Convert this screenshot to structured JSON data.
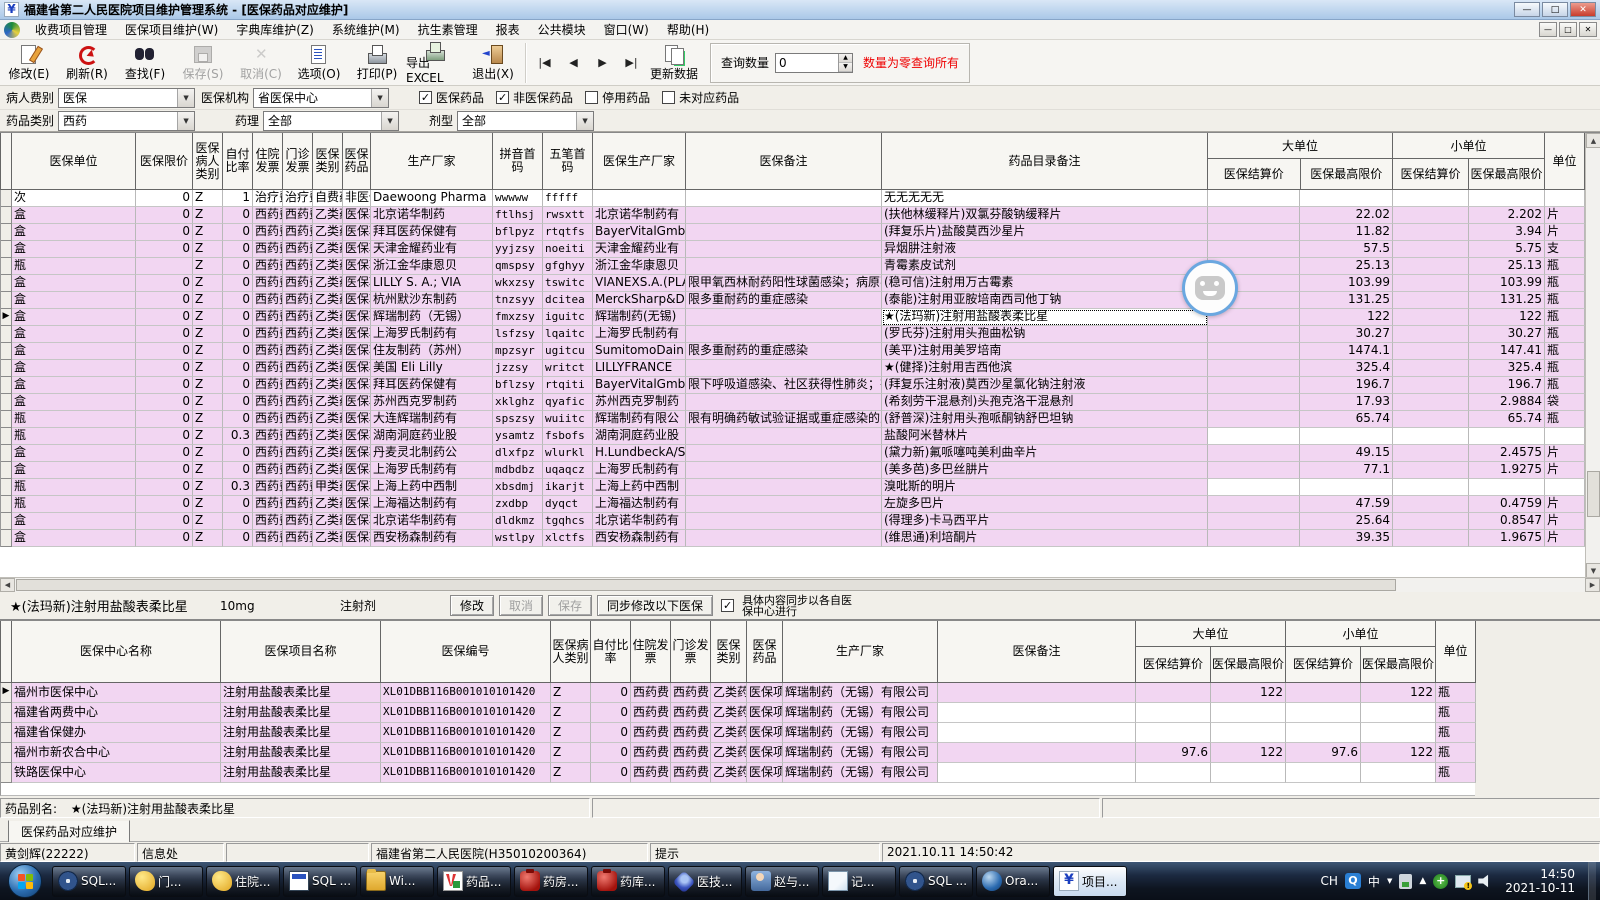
{
  "window": {
    "title": "福建省第二人民医院项目维护管理系统 - [医保药品对应维护]"
  },
  "icons": {
    "dropdown": "▼",
    "spin_up": "▲",
    "spin_down": "▼",
    "check": "✓",
    "nav_first": "|◀",
    "nav_prev": "◀",
    "nav_next": "▶",
    "nav_last": "▶|",
    "scroll_up": "▲",
    "scroll_down": "▼",
    "scroll_left": "◀",
    "scroll_right": "▶",
    "minimize": "—",
    "maximize": "□",
    "close": "✕",
    "restore": "□",
    "app_glyph": "¥"
  },
  "menu": [
    "收费项目管理",
    "医保项目维护(W)",
    "字典库维护(Z)",
    "系统维护(M)",
    "抗生素管理",
    "报表",
    "公共模块",
    "窗口(W)",
    "帮助(H)"
  ],
  "toolbar": {
    "buttons": [
      {
        "label": "修改(E)"
      },
      {
        "label": "刷新(R)"
      },
      {
        "label": "查找(F)"
      },
      {
        "label": "保存(S)"
      },
      {
        "label": "取消(C)"
      },
      {
        "label": "选项(O)"
      },
      {
        "label": "打印(P)"
      },
      {
        "label": "导出EXCEL"
      },
      {
        "label": "退出(X)"
      }
    ],
    "update_label": "更新数据",
    "query_label": "查询数量",
    "query_value": "0",
    "query_hint": "数量为零查询所有",
    "hint_color": "#ee0000"
  },
  "filters": {
    "patient_fee_label": "病人费别",
    "patient_fee_value": "医保",
    "org_label": "医保机构",
    "org_value": "省医保中心",
    "checks": [
      {
        "label": "医保药品",
        "state": "on"
      },
      {
        "label": "非医保药品",
        "state": "on"
      },
      {
        "label": "停用药品",
        "state": "off"
      },
      {
        "label": "未对应药品",
        "state": "off"
      }
    ],
    "drug_class_label": "药品类别",
    "drug_class_value": "西药",
    "pharm_label": "药理",
    "pharm_value": "全部",
    "form_label": "剂型",
    "form_value": "全部"
  },
  "main_table": {
    "headers": {
      "unit": "医保单位",
      "limit": "医保限价",
      "ptype": "医保病人类别",
      "ratio": "自付比率",
      "inv_in": "住院发票",
      "inv_out": "门诊发票",
      "cls": "医保类别",
      "drug": "医保药品",
      "factory": "生产厂家",
      "py": "拼音首码",
      "wb": "五笔首码",
      "yb_factory": "医保生产厂家",
      "remark": "医保备注",
      "catalog": "药品目录备注",
      "big": "大单位",
      "small": "小单位",
      "settle": "医保结算价",
      "max": "医保最高限价",
      "unit2": "单位"
    },
    "rows": [
      {
        "u": "次",
        "lim": "0",
        "pt": "Z",
        "ra": "1",
        "i1": "治疗费",
        "i2": "治疗费",
        "cl": "自费药",
        "dr": "非医保",
        "fa": "Daewoong Pharma",
        "py": "wwwww",
        "wb": "fffff",
        "yf": "",
        "re": "",
        "ca": "无无无无无",
        "p1": "",
        "p2": "",
        "p3": "",
        "p4": "",
        "un": "",
        "cls": "w"
      },
      {
        "u": "盒",
        "lim": "0",
        "pt": "Z",
        "ra": "0",
        "i1": "西药费",
        "i2": "西药费",
        "cl": "乙类药",
        "dr": "医保项",
        "fa": "北京诺华制药",
        "py": "ftlhsj",
        "wb": "rwsxtt",
        "yf": "北京诺华制药有",
        "re": "",
        "ca": "(扶他林缓释片)双氯芬酸钠缓释片",
        "p1": "",
        "p2": "22.02",
        "p3": "",
        "p4": "2.202",
        "un": "片"
      },
      {
        "u": "盒",
        "lim": "0",
        "pt": "Z",
        "ra": "0",
        "i1": "西药费",
        "i2": "西药费",
        "cl": "乙类药",
        "dr": "医保项",
        "fa": "拜耳医药保健有",
        "py": "bflpyz",
        "wb": "rtqtfs",
        "yf": "BayerVitalGmbH",
        "re": "",
        "ca": "(拜复乐片)盐酸莫西沙星片",
        "p1": "",
        "p2": "11.82",
        "p3": "",
        "p4": "3.94",
        "un": "片"
      },
      {
        "u": "盒",
        "lim": "0",
        "pt": "Z",
        "ra": "0",
        "i1": "西药费",
        "i2": "西药费",
        "cl": "乙类药",
        "dr": "医保项",
        "fa": "天津金耀药业有",
        "py": "yyjzsy",
        "wb": "noeiti",
        "yf": "天津金耀药业有",
        "re": "",
        "ca": "异烟肼注射液",
        "p1": "",
        "p2": "57.5",
        "p3": "",
        "p4": "5.75",
        "un": "支"
      },
      {
        "u": "瓶",
        "lim": "",
        "pt": "Z",
        "ra": "0",
        "i1": "西药费",
        "i2": "西药费",
        "cl": "乙类药",
        "dr": "医保项",
        "fa": "浙江金华康恩贝",
        "py": "qmspsy",
        "wb": "gfghyy",
        "yf": "浙江金华康恩贝",
        "re": "",
        "ca": "青霉素皮试剂",
        "p1": "",
        "p2": "25.13",
        "p3": "",
        "p4": "25.13",
        "un": "瓶"
      },
      {
        "u": "盒",
        "lim": "0",
        "pt": "Z",
        "ra": "0",
        "i1": "西药费",
        "i2": "西药费",
        "cl": "乙类药",
        "dr": "医保项",
        "fa": "LILLY S. A.; VIA",
        "py": "wkxzsy",
        "wb": "tswitc",
        "yf": "VIANEXS.A.(PLA",
        "re": "限甲氧西林耐药阳性球菌感染；病原不",
        "ca": "(稳可信)注射用万古霉素",
        "p1": "",
        "p2": "103.99",
        "p3": "",
        "p4": "103.99",
        "un": "瓶"
      },
      {
        "u": "盒",
        "lim": "0",
        "pt": "Z",
        "ra": "0",
        "i1": "西药费",
        "i2": "西药费",
        "cl": "乙类药",
        "dr": "医保项",
        "fa": "杭州默沙东制药",
        "py": "tnzsyy",
        "wb": "dcitea",
        "yf": "MerckSharp&Doh",
        "re": "限多重耐药的重症感染",
        "ca": "(泰能)注射用亚胺培南西司他丁钠",
        "p1": "",
        "p2": "131.25",
        "p3": "",
        "p4": "131.25",
        "un": "瓶"
      },
      {
        "mk": "▶",
        "u": "盒",
        "lim": "0",
        "pt": "Z",
        "ra": "0",
        "i1": "西药费",
        "i2": "西药费",
        "cl": "乙类药",
        "dr": "医保项",
        "fa": "辉瑞制药（无锡）",
        "py": "fmxzsy",
        "wb": "iguitc",
        "yf": "辉瑞制药(无锡)",
        "re": "",
        "ca": "★(法玛新)注射用盐酸表柔比星",
        "p1": "",
        "p2": "122",
        "p3": "",
        "p4": "122",
        "un": "瓶",
        "cls": "cur"
      },
      {
        "u": "盒",
        "lim": "0",
        "pt": "Z",
        "ra": "0",
        "i1": "西药费",
        "i2": "西药费",
        "cl": "乙类药",
        "dr": "医保项",
        "fa": "上海罗氏制药有",
        "py": "lsfzsy",
        "wb": "lqaitc",
        "yf": "上海罗氏制药有",
        "re": "",
        "ca": "(罗氏芬)注射用头孢曲松钠",
        "p1": "",
        "p2": "30.27",
        "p3": "",
        "p4": "30.27",
        "un": "瓶"
      },
      {
        "u": "盒",
        "lim": "0",
        "pt": "Z",
        "ra": "0",
        "i1": "西药费",
        "i2": "西药费",
        "cl": "乙类药",
        "dr": "医保项",
        "fa": "住友制药（苏州）",
        "py": "mpzsyr",
        "wb": "ugitcu",
        "yf": "SumitomoDainip",
        "re": "限多重耐药的重症感染",
        "ca": "(美平)注射用美罗培南",
        "p1": "",
        "p2": "1474.1",
        "p3": "",
        "p4": "147.41",
        "un": "瓶"
      },
      {
        "u": "盒",
        "lim": "0",
        "pt": "Z",
        "ra": "0",
        "i1": "西药费",
        "i2": "西药费",
        "cl": "乙类药",
        "dr": "医保项",
        "fa": "美国 Eli Lilly",
        "py": "jzzsy",
        "wb": "writct",
        "yf": "LILLYFRANCE",
        "re": "",
        "ca": "★(健择)注射用吉西他滨",
        "p1": "",
        "p2": "325.4",
        "p3": "",
        "p4": "325.4",
        "un": "瓶"
      },
      {
        "u": "盒",
        "lim": "0",
        "pt": "Z",
        "ra": "0",
        "i1": "西药费",
        "i2": "西药费",
        "cl": "乙类药",
        "dr": "医保项",
        "fa": "拜耳医药保健有",
        "py": "bflzsy",
        "wb": "rtqiti",
        "yf": "BayerVitalGmbH",
        "re": "限下呼吸道感染、社区获得性肺炎；有",
        "ca": "(拜复乐注射液)莫西沙星氯化钠注射液",
        "p1": "",
        "p2": "196.7",
        "p3": "",
        "p4": "196.7",
        "un": "瓶"
      },
      {
        "u": "盒",
        "lim": "0",
        "pt": "Z",
        "ra": "0",
        "i1": "西药费",
        "i2": "西药费",
        "cl": "乙类药",
        "dr": "医保项",
        "fa": "苏州西克罗制药",
        "py": "xklghz",
        "wb": "qyafic",
        "yf": "苏州西克罗制药",
        "re": "",
        "ca": "(希刻劳干混悬剂)头孢克洛干混悬剂",
        "p1": "",
        "p2": "17.93",
        "p3": "",
        "p4": "2.9884",
        "un": "袋"
      },
      {
        "u": "瓶",
        "lim": "0",
        "pt": "Z",
        "ra": "0",
        "i1": "西药费",
        "i2": "西药费",
        "cl": "乙类药",
        "dr": "医保项",
        "fa": "大连辉瑞制药有",
        "py": "spszsy",
        "wb": "wuiitc",
        "yf": "辉瑞制药有限公",
        "re": "限有明确药敏试验证据或重症感染的患",
        "ca": "(舒普深)注射用头孢哌酮钠舒巴坦钠",
        "p1": "",
        "p2": "65.74",
        "p3": "",
        "p4": "65.74",
        "un": "瓶"
      },
      {
        "u": "瓶",
        "lim": "0",
        "pt": "Z",
        "ra": "0.3",
        "i1": "西药费",
        "i2": "西药费",
        "cl": "乙类药",
        "dr": "医保项",
        "fa": "湖南洞庭药业股",
        "py": "ysamtz",
        "wb": "fsbofs",
        "yf": "湖南洞庭药业股",
        "re": "",
        "ca": "盐酸阿米替林片",
        "p1": "",
        "p2": "",
        "p3": "",
        "p4": "",
        "un": "",
        "cls": "nop"
      },
      {
        "u": "盒",
        "lim": "0",
        "pt": "Z",
        "ra": "0",
        "i1": "西药费",
        "i2": "西药费",
        "cl": "乙类药",
        "dr": "医保项",
        "fa": "丹麦灵北制药公",
        "py": "dlxfpz",
        "wb": "wlurkl",
        "yf": "H.LundbeckA/S",
        "re": "",
        "ca": "(黛力新)氟哌噻吨美利曲辛片",
        "p1": "",
        "p2": "49.15",
        "p3": "",
        "p4": "2.4575",
        "un": "片"
      },
      {
        "u": "盒",
        "lim": "0",
        "pt": "Z",
        "ra": "0",
        "i1": "西药费",
        "i2": "西药费",
        "cl": "乙类药",
        "dr": "医保项",
        "fa": "上海罗氏制药有",
        "py": "mdbdbz",
        "wb": "uqaqcz",
        "yf": "上海罗氏制药有",
        "re": "",
        "ca": "(美多芭)多巴丝肼片",
        "p1": "",
        "p2": "77.1",
        "p3": "",
        "p4": "1.9275",
        "un": "片"
      },
      {
        "u": "瓶",
        "lim": "0",
        "pt": "Z",
        "ra": "0.3",
        "i1": "西药费",
        "i2": "西药费",
        "cl": "甲类药",
        "dr": "医保项",
        "fa": "上海上药中西制",
        "py": "xbsdmj",
        "wb": "ikarjt",
        "yf": "上海上药中西制",
        "re": "",
        "ca": "溴吡斯的明片",
        "p1": "",
        "p2": "",
        "p3": "",
        "p4": "",
        "un": "",
        "cls": "nop"
      },
      {
        "u": "瓶",
        "lim": "0",
        "pt": "Z",
        "ra": "0",
        "i1": "西药费",
        "i2": "西药费",
        "cl": "乙类药",
        "dr": "医保项",
        "fa": "上海福达制药有",
        "py": "zxdbp",
        "wb": "dyqct",
        "yf": "上海福达制药有",
        "re": "",
        "ca": "左旋多巴片",
        "p1": "",
        "p2": "47.59",
        "p3": "",
        "p4": "0.4759",
        "un": "片"
      },
      {
        "u": "盒",
        "lim": "0",
        "pt": "Z",
        "ra": "0",
        "i1": "西药费",
        "i2": "西药费",
        "cl": "乙类药",
        "dr": "医保项",
        "fa": "北京诺华制药有",
        "py": "dldkmz",
        "wb": "tgqhcs",
        "yf": "北京诺华制药有",
        "re": "",
        "ca": "(得理多)卡马西平片",
        "p1": "",
        "p2": "25.64",
        "p3": "",
        "p4": "0.8547",
        "un": "片"
      },
      {
        "u": "盒",
        "lim": "0",
        "pt": "Z",
        "ra": "0",
        "i1": "西药费",
        "i2": "西药费",
        "cl": "乙类药",
        "dr": "医保项",
        "fa": "西安杨森制药有",
        "py": "wstlpy",
        "wb": "xlctfs",
        "yf": "西安杨森制药有",
        "re": "",
        "ca": "(维思通)利培酮片",
        "p1": "",
        "p2": "39.35",
        "p3": "",
        "p4": "1.9675",
        "un": "片"
      }
    ]
  },
  "detail": {
    "name": "★(法玛新)注射用盐酸表柔比星",
    "spec": "10mg",
    "form": "注射剂",
    "edit_label": "修改",
    "cancel_label": "取消",
    "save_label": "保存",
    "sync_label": "同步修改以下医保",
    "sync_checked": "on",
    "sync_note": "具体内容同步以各自医保中心进行"
  },
  "sub_table": {
    "headers": {
      "center": "医保中心名称",
      "proj": "医保项目名称",
      "code": "医保编号",
      "ptype": "医保病人类别",
      "ratio": "自付比率",
      "inv_in": "住院发票",
      "inv_out": "门诊发票",
      "cls": "医保类别",
      "drug": "医保药品",
      "factory": "生产厂家",
      "remark": "医保备注",
      "big": "大单位",
      "small": "小单位",
      "settle": "医保结算价",
      "max": "医保最高限价",
      "unit": "单位"
    },
    "rows": [
      {
        "mk": "▶",
        "name": "福州市医保中心",
        "proj": "注射用盐酸表柔比星",
        "code": "XL01DBB116B001010101420",
        "pt": "Z",
        "ra": "0",
        "i1": "西药费",
        "i2": "西药费",
        "cl": "乙类药",
        "dr": "医保项",
        "fa": "辉瑞制药（无锡）有限公司",
        "re": "",
        "p1": "",
        "p2": "122",
        "p3": "",
        "p4": "122",
        "un": "瓶"
      },
      {
        "name": "福建省两费中心",
        "proj": "注射用盐酸表柔比星",
        "code": "XL01DBB116B001010101420",
        "pt": "Z",
        "ra": "0",
        "i1": "西药费",
        "i2": "西药费",
        "cl": "乙类药",
        "dr": "医保项",
        "fa": "辉瑞制药（无锡）有限公司",
        "re": "",
        "p1": "",
        "p2": "",
        "p3": "",
        "p4": "",
        "un": "瓶",
        "cls": "nop"
      },
      {
        "name": "福建省保健办",
        "proj": "注射用盐酸表柔比星",
        "code": "XL01DBB116B001010101420",
        "pt": "Z",
        "ra": "0",
        "i1": "西药费",
        "i2": "西药费",
        "cl": "乙类药",
        "dr": "医保项",
        "fa": "辉瑞制药（无锡）有限公司",
        "re": "",
        "p1": "",
        "p2": "",
        "p3": "",
        "p4": "",
        "un": "瓶",
        "cls": "nop"
      },
      {
        "name": "福州市新农合中心",
        "proj": "注射用盐酸表柔比星",
        "code": "XL01DBB116B001010101420",
        "pt": "Z",
        "ra": "0",
        "i1": "西药费",
        "i2": "西药费",
        "cl": "乙类药",
        "dr": "医保项",
        "fa": "辉瑞制药（无锡）有限公司",
        "re": "",
        "p1": "97.6",
        "p2": "122",
        "p3": "97.6",
        "p4": "122",
        "un": "瓶"
      },
      {
        "name": "铁路医保中心",
        "proj": "注射用盐酸表柔比星",
        "code": "XL01DBB116B001010101420",
        "pt": "Z",
        "ra": "0",
        "i1": "西药费",
        "i2": "西药费",
        "cl": "乙类药",
        "dr": "医保项",
        "fa": "辉瑞制药（无锡）有限公司",
        "re": "",
        "p1": "",
        "p2": "",
        "p3": "",
        "p4": "",
        "un": "瓶",
        "cls": "nop"
      }
    ]
  },
  "alias": {
    "label": "药品别名:",
    "value": "★(法玛新)注射用盐酸表柔比星"
  },
  "tab_label": "医保药品对应维护",
  "status": {
    "user": "黄剑辉(22222)",
    "dept": "信息处",
    "empty": "",
    "hospital": "福建省第二人民医院(H35010200364)",
    "hint": "提示",
    "datetime": "2021.10.11  14:50:42"
  },
  "taskbar": {
    "items": [
      {
        "label": "SQL..."
      },
      {
        "label": "门..."
      },
      {
        "label": "住院..."
      },
      {
        "label": "SQL ..."
      },
      {
        "label": "Wi..."
      },
      {
        "label": "药品..."
      },
      {
        "label": "药房..."
      },
      {
        "label": "药库..."
      },
      {
        "label": "医技..."
      },
      {
        "label": "赵与..."
      },
      {
        "label": "记..."
      },
      {
        "label": "SQL ..."
      },
      {
        "label": "Ora..."
      },
      {
        "label": "项目..."
      }
    ],
    "tray": {
      "lang": "CH",
      "ime_btn": "Q",
      "ime_mode": "中",
      "clock_time": "14:50",
      "clock_date": "2021-10-11"
    }
  }
}
